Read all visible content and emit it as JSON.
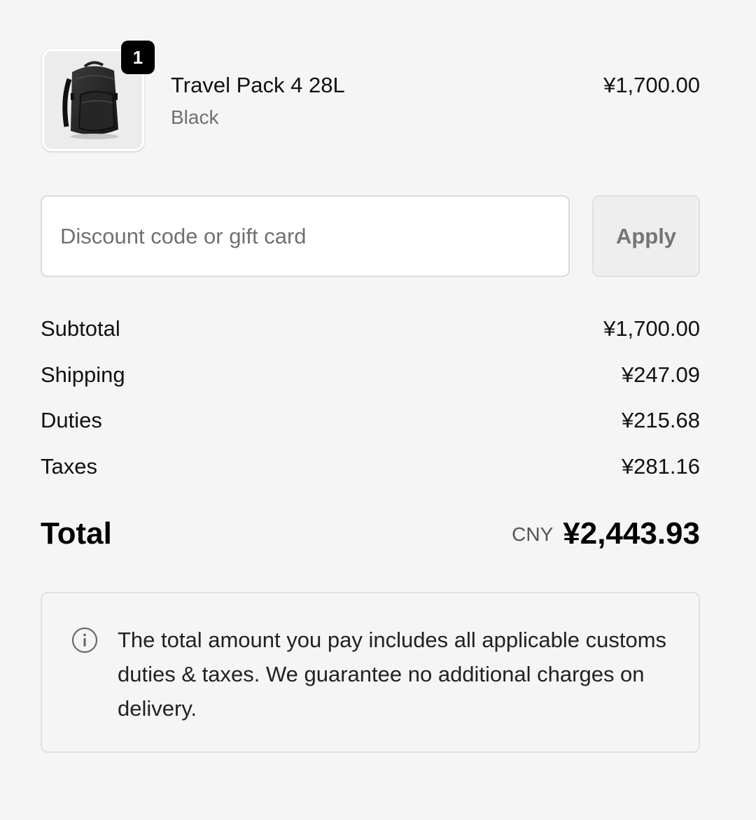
{
  "line_item": {
    "quantity": "1",
    "name": "Travel Pack 4 28L",
    "variant": "Black",
    "price": "¥1,700.00",
    "image_icon": "backpack-image"
  },
  "discount": {
    "placeholder": "Discount code or gift card",
    "value": "",
    "apply_label": "Apply"
  },
  "costs": {
    "subtotal": {
      "label": "Subtotal",
      "value": "¥1,700.00"
    },
    "shipping": {
      "label": "Shipping",
      "value": "¥247.09"
    },
    "duties": {
      "label": "Duties",
      "value": "¥215.68"
    },
    "taxes": {
      "label": "Taxes",
      "value": "¥281.16"
    }
  },
  "total": {
    "label": "Total",
    "currency": "CNY",
    "amount": "¥2,443.93"
  },
  "notice": {
    "icon": "info-icon",
    "text": "The total amount you pay includes all applicable customs duties & taxes. We guarantee no additional charges on delivery."
  },
  "colors": {
    "background": "#f5f5f5",
    "badge": "#000000",
    "muted_text": "#707070"
  }
}
